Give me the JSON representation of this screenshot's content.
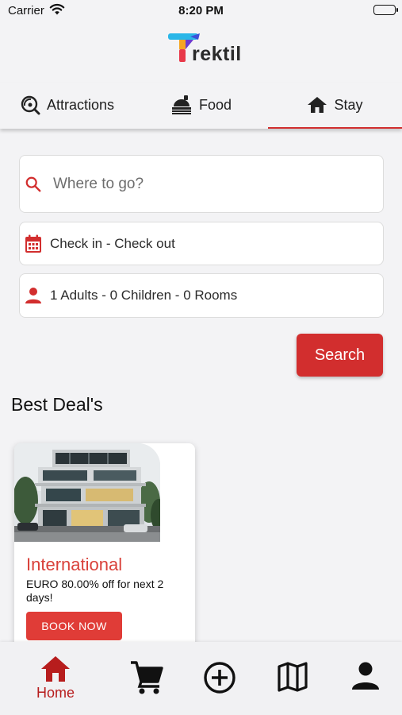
{
  "status_bar": {
    "carrier": "Carrier",
    "time": "8:20 PM"
  },
  "brand": {
    "logo_text": "rektil",
    "logo_mark_letter": "T"
  },
  "tabs": [
    {
      "label": "Attractions",
      "icon": "attractions-search-icon",
      "active": false
    },
    {
      "label": "Food",
      "icon": "food-tray-icon",
      "active": false
    },
    {
      "label": "Stay",
      "icon": "home-icon",
      "active": true
    }
  ],
  "search": {
    "destination_placeholder": "Where to go?",
    "destination_value": "",
    "dates_label": "Check in - Check out",
    "guests_label": "1 Adults - 0 Children - 0 Rooms",
    "button_label": "Search"
  },
  "best_deals": {
    "title": "Best Deal's",
    "items": [
      {
        "title": "International",
        "description": "EURO 80.00% off for next 2 days!",
        "button_label": "BOOK NOW",
        "image": "modern-building-photo"
      }
    ]
  },
  "bottom_nav": [
    {
      "label": "Home",
      "icon": "home-icon",
      "active": true
    },
    {
      "label": "",
      "icon": "cart-icon",
      "active": false
    },
    {
      "label": "",
      "icon": "add-circle-icon",
      "active": false
    },
    {
      "label": "",
      "icon": "map-icon",
      "active": false
    },
    {
      "label": "",
      "icon": "profile-icon",
      "active": false
    }
  ],
  "colors": {
    "accent": "#d22e2e",
    "deal_title": "#d9413a",
    "nav_active": "#b71d1d",
    "background": "#f3f3f5"
  }
}
